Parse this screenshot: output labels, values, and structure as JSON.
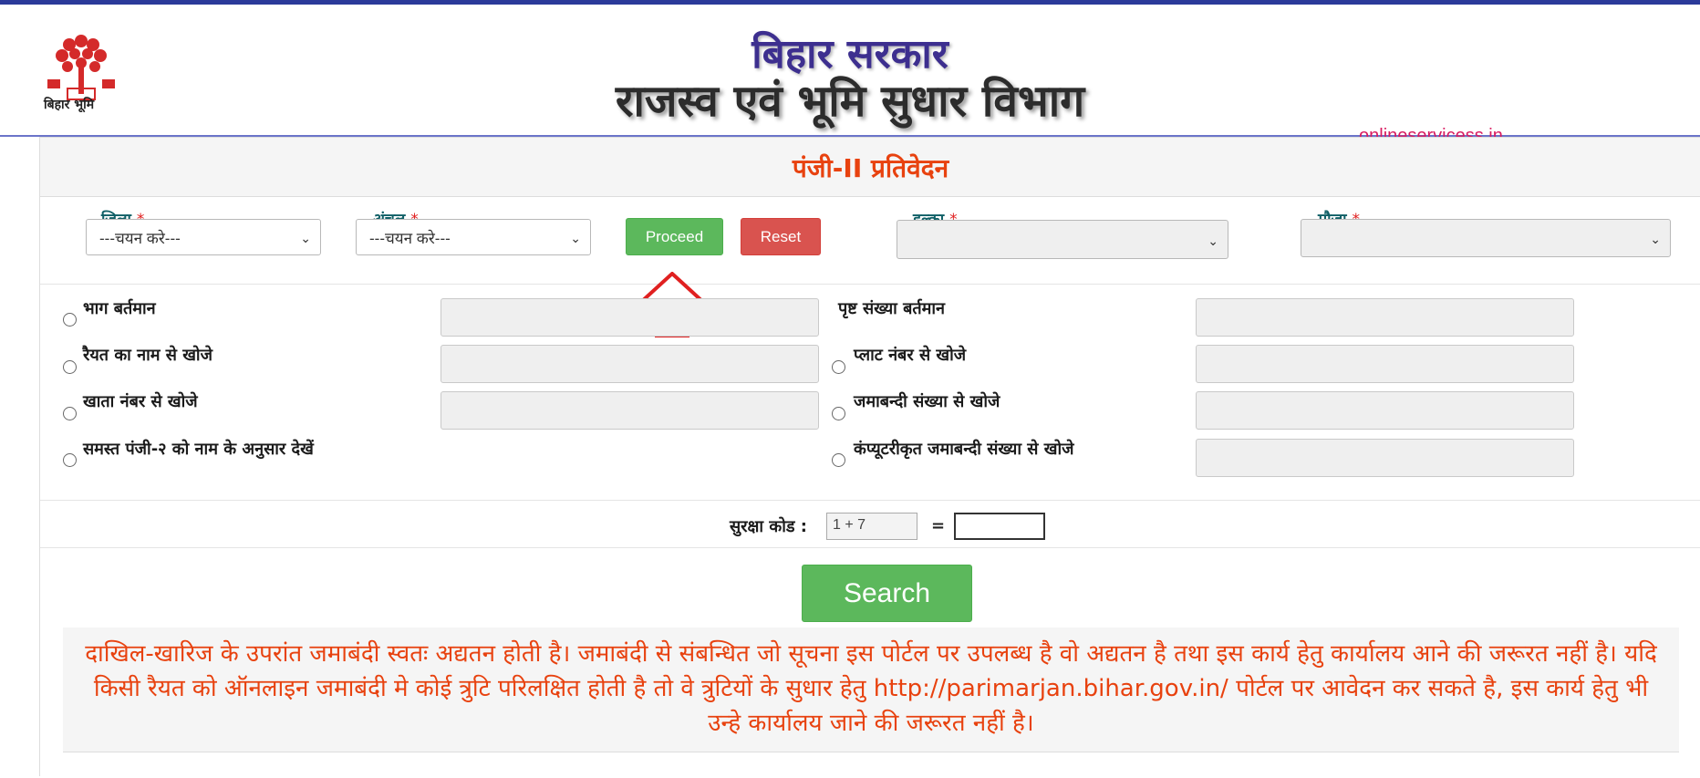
{
  "header": {
    "logo_text": "बिहार भूमि",
    "title_line1": "बिहार सरकार",
    "title_line2": "राजस्व एवं भूमि सुधार विभाग",
    "watermark": "onlineservicess.in"
  },
  "panel": {
    "title": "पंजी-II प्रतिवेदन"
  },
  "filters": {
    "district_label": "जिला",
    "district_value": "---चयन करे---",
    "circle_label": "अंचल",
    "circle_value": "---चयन करे---",
    "proceed_label": "Proceed",
    "reset_label": "Reset",
    "halka_label": "हल्का",
    "halka_value": "",
    "mauza_label": "मौजा",
    "mauza_value": "",
    "required_mark": "*",
    "info_icon_glyph": "i"
  },
  "options": {
    "bhag": "भाग बर्तमान",
    "prishth": "पृष्ट संख्या बर्तमान",
    "raiyat": "रैयत का नाम से खोजे",
    "plot": "प्लाट नंबर से खोजे",
    "khata": "खाता नंबर से खोजे",
    "jamabandi": "जमाबन्दी संख्या से खोजे",
    "samast": "समस्त पंजी-२ को नाम के अनुसार देखें",
    "computerized": "कंप्यूटरीकृत जमाबन्दी संख्या से खोजे"
  },
  "captcha": {
    "label": "सुरक्षा कोड :",
    "question": "1 + 7",
    "equals": "=",
    "answer": ""
  },
  "search_label": "Search",
  "notice": "दाखिल-खारिज के उपरांत जमाबंदी स्वतः अद्यतन होती है। जमाबंदी से संबन्धित जो सूचना इस पोर्टल पर उपलब्ध है वो अद्यतन है तथा इस कार्य हेतु कार्यालय आने की जरूरत नहीं है। यदि किसी रैयत को ऑनलाइन जमाबंदी मे कोई त्रुटि परिलक्षित होती है तो वे त्रुटियों के सुधार हेतु http://parimarjan.bihar.gov.in/ पोर्टल पर आवेदन कर सकते है, इस कार्य हेतु भी उन्हे कार्यालय जाने की जरूरत नहीं है।",
  "colors": {
    "accent_orange": "#e8420f",
    "label_teal": "#0f5f66",
    "green_button": "#5cb85c",
    "red_button": "#d9534f",
    "watermark_pink": "#d81b60"
  }
}
